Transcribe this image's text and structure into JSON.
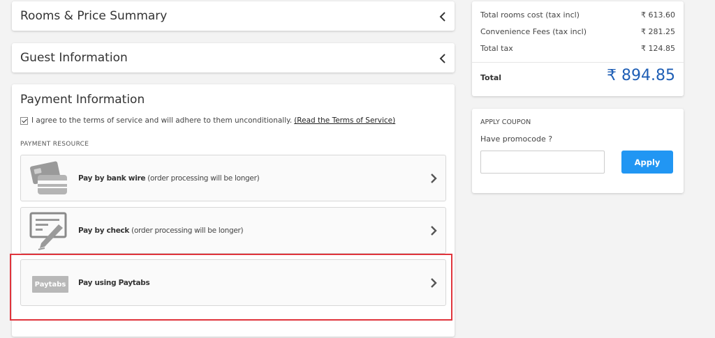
{
  "accordion": {
    "rooms_title": "Rooms & Price Summary",
    "guest_title": "Guest Information"
  },
  "payment": {
    "title": "Payment Information",
    "terms_text": "I agree to the terms of service and will adhere to them unconditionally.",
    "terms_link": "(Read the Terms of Service)",
    "section_label": "PAYMENT RESOURCE",
    "options": [
      {
        "bold": "Pay by bank wire",
        "note": " (order processing will be longer)",
        "icon": "bank-card-icon"
      },
      {
        "bold": "Pay by check",
        "note": " (order processing will be longer)",
        "icon": "check-pen-icon"
      },
      {
        "bold": "Pay using Paytabs",
        "note": "",
        "icon": "paytabs-logo",
        "logo_text": "Paytabs"
      }
    ]
  },
  "summary": {
    "rows": [
      {
        "label": "Total rooms cost (tax incl)",
        "value": "₹ 613.60"
      },
      {
        "label": "Convenience Fees (tax incl)",
        "value": "₹ 281.25"
      },
      {
        "label": "Total tax",
        "value": "₹ 124.85"
      }
    ],
    "total_label": "Total",
    "total_value": "₹ 894.85"
  },
  "coupon": {
    "title": "APPLY COUPON",
    "promo_label": "Have promocode ?",
    "input_value": "",
    "apply_label": "Apply"
  },
  "colors": {
    "accent": "#2196f3",
    "total": "#1e5eb5",
    "highlight": "#e0343c"
  }
}
